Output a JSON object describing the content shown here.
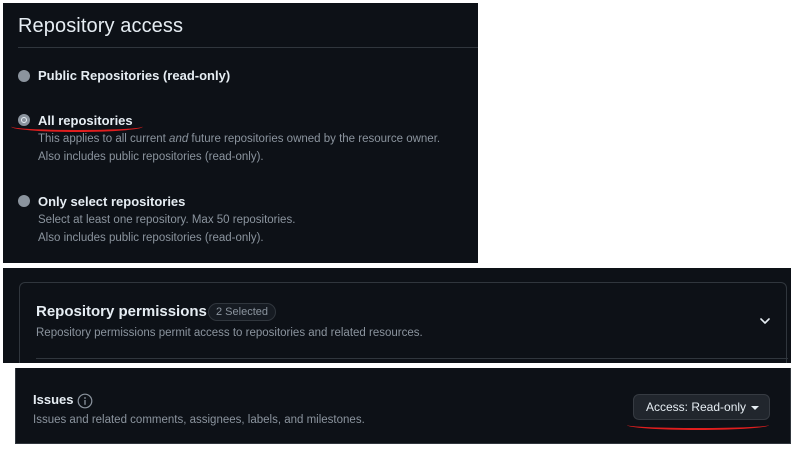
{
  "repository_access": {
    "title": "Repository access",
    "options": [
      {
        "label": "Public Repositories (read-only)",
        "checked": false,
        "description": []
      },
      {
        "label": "All repositories",
        "checked": true,
        "description": [
          "This applies to all current and future repositories owned by the resource owner.",
          "Also includes public repositories (read-only)."
        ]
      },
      {
        "label": "Only select repositories",
        "checked": false,
        "description": [
          "Select at least one repository. Max 50 repositories.",
          "Also includes public repositories (read-only)."
        ]
      }
    ]
  },
  "repository_permissions": {
    "title": "Repository permissions",
    "badge": "2 Selected",
    "description": "Repository permissions permit access to repositories and related resources.",
    "expand_icon": "chevron-down-icon"
  },
  "issues": {
    "label": "Issues",
    "info_icon": "info-icon",
    "description": "Issues and related comments, assignees, labels, and milestones.",
    "access_button": "Access: Read-only"
  },
  "colors": {
    "background": "#0d1117",
    "border": "#30363d",
    "text": "#e6edf3",
    "muted": "#8b949e",
    "highlight": "#e01e1e"
  }
}
